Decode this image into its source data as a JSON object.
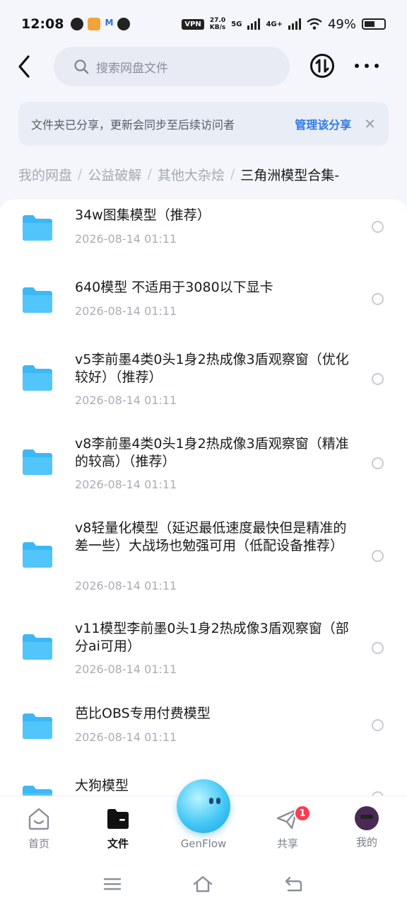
{
  "status": {
    "time": "12:08",
    "vpn": "VPN",
    "speed_value": "27.0",
    "speed_unit": "KB/s",
    "net1": "5G",
    "net2": "4G+",
    "battery": "49%"
  },
  "header": {
    "search_placeholder": "搜索网盘文件",
    "back_icon": "chevron-left-icon",
    "transfer_icon": "transfer-icon",
    "more_icon": "more-icon"
  },
  "share_banner": {
    "text": "文件夹已分享，更新会同步至后续访问者",
    "manage": "管理该分享",
    "close": "✕"
  },
  "breadcrumb": {
    "items": [
      "我的网盘",
      "公益破解",
      "其他大杂烩",
      "三角洲模型合集-"
    ],
    "separator": "/"
  },
  "files": [
    {
      "name": "34w图集模型（推荐）",
      "date": "2026-08-14  01:11"
    },
    {
      "name": "640模型 不适用于3080以下显卡",
      "date": "2026-08-14  01:11"
    },
    {
      "name": "v5李前墨4类0头1身2热成像3盾观察窗（优化较好）（推荐）",
      "date": "2026-08-14  01:11"
    },
    {
      "name": "v8李前墨4类0头1身2热成像3盾观察窗（精准的较高）（推荐）",
      "date": "2026-08-14  01:11"
    },
    {
      "name": "v8轻量化模型（延迟最低速度最快但是精准的差一些）大战场也勉强可用（低配设备推荐）",
      "date": "2026-08-14  01:11"
    },
    {
      "name": "v11模型李前墨0头1身2热成像3盾观察窗（部分ai可用）",
      "date": "2026-08-14  01:11"
    },
    {
      "name": "芭比OBS专用付费模型",
      "date": "2026-08-14  01:11"
    },
    {
      "name": "大狗模型",
      "date": ""
    }
  ],
  "tabs": {
    "home": "首页",
    "files": "文件",
    "genflow": "GenFlow",
    "share": "共享",
    "share_badge": "1",
    "mine": "我的"
  },
  "colors": {
    "accent": "#2f7be8",
    "folder": "#3cb8f6",
    "badge": "#ff3b4f"
  }
}
